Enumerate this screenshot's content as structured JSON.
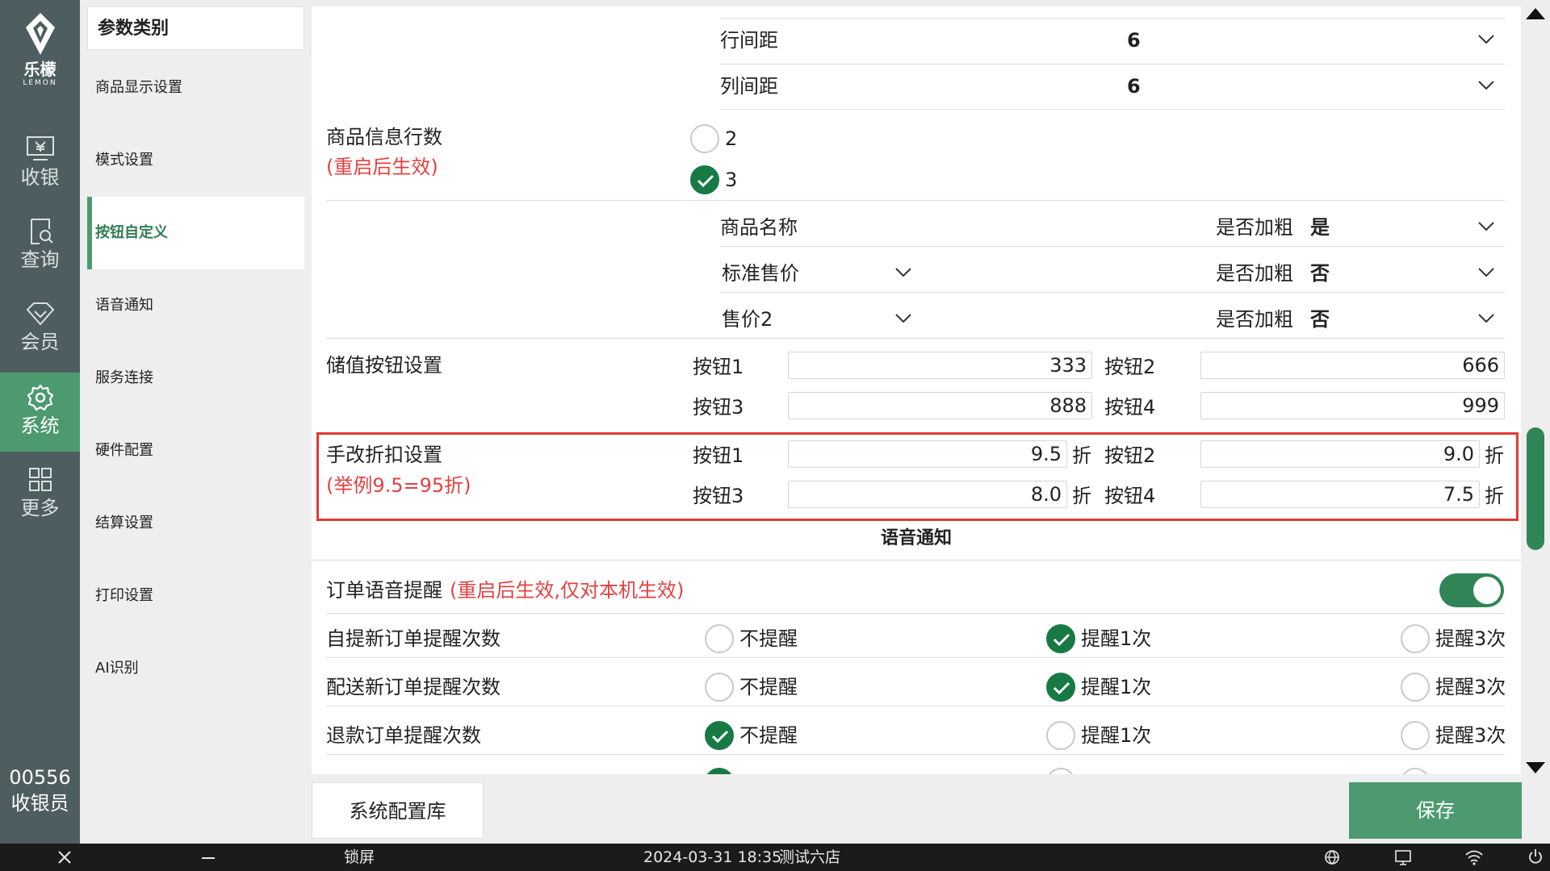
{
  "brand": {
    "name": "乐檬",
    "sub": "LEMON"
  },
  "nav": [
    {
      "label": "收银",
      "icon": "cashier-icon"
    },
    {
      "label": "查询",
      "icon": "query-icon"
    },
    {
      "label": "会员",
      "icon": "member-icon"
    },
    {
      "label": "系统",
      "icon": "gear-icon",
      "active": true
    },
    {
      "label": "更多",
      "icon": "grid-icon"
    }
  ],
  "operator": {
    "id": "00556",
    "role": "收银员"
  },
  "categories": {
    "title": "参数类别",
    "items": [
      "商品显示设置",
      "模式设置",
      "按钮自定义",
      "语音通知",
      "服务连接",
      "硬件配置",
      "结算设置",
      "打印设置",
      "AI识别"
    ],
    "active_index": 2
  },
  "display": {
    "row_spacing": {
      "label": "行间距",
      "value": "6"
    },
    "col_spacing": {
      "label": "列间距",
      "value": "6"
    },
    "info_rows": {
      "label": "商品信息行数",
      "note": "(重启后生效)",
      "options": [
        "2",
        "3"
      ],
      "selected": "3"
    },
    "fields": [
      {
        "name": "商品名称",
        "bold_label": "是否加粗",
        "bold_value": "是",
        "has_dropdown": false
      },
      {
        "name": "标准售价",
        "bold_label": "是否加粗",
        "bold_value": "否",
        "has_dropdown": true
      },
      {
        "name": "售价2",
        "bold_label": "是否加粗",
        "bold_value": "否",
        "has_dropdown": true
      }
    ]
  },
  "stored_value": {
    "label": "储值按钮设置",
    "buttons": [
      {
        "label": "按钮1",
        "value": "333"
      },
      {
        "label": "按钮2",
        "value": "666"
      },
      {
        "label": "按钮3",
        "value": "888"
      },
      {
        "label": "按钮4",
        "value": "999"
      }
    ]
  },
  "discount": {
    "label": "手改折扣设置",
    "note": "(举例9.5=95折)",
    "unit": "折",
    "buttons": [
      {
        "label": "按钮1",
        "value": "9.5"
      },
      {
        "label": "按钮2",
        "value": "9.0"
      },
      {
        "label": "按钮3",
        "value": "8.0"
      },
      {
        "label": "按钮4",
        "value": "7.5"
      }
    ]
  },
  "voice": {
    "section_title": "语音通知",
    "order_voice": {
      "label": "订单语音提醒",
      "note": "(重启后生效,仅对本机生效)",
      "enabled": true
    },
    "options": [
      "不提醒",
      "提醒1次",
      "提醒3次"
    ],
    "rows": [
      {
        "label": "自提新订单提醒次数",
        "selected": 1
      },
      {
        "label": "配送新订单提醒次数",
        "selected": 1
      },
      {
        "label": "退款订单提醒次数",
        "selected": 0
      }
    ]
  },
  "actions": {
    "config_library": "系统配置库",
    "save": "保存"
  },
  "statusbar": {
    "lock": "锁屏",
    "datetime": "2024-03-31 18:35",
    "store": "测试六店"
  },
  "colors": {
    "primary": "#4d9a70",
    "rail": "#4e5d5f",
    "check": "#177a45",
    "warning": "#e34141",
    "highlight": "#e53935"
  }
}
